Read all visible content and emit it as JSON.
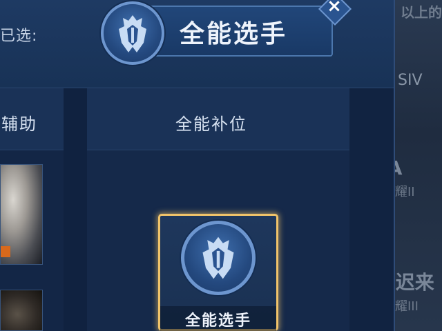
{
  "background": {
    "top_text": "以上的",
    "rank_1": "SIV",
    "player_1": "凉(A",
    "rank_1b": "耀II",
    "player_2": "(迟来",
    "rank_2": "耀III"
  },
  "dialog": {
    "title": "全能选手",
    "already_selected_label": "已选:",
    "close_icon": "×"
  },
  "columns": {
    "support_label": "辅助",
    "allround_label": "全能补位"
  },
  "selected_card": {
    "caption": "全能选手",
    "icon": "helmet-icon"
  },
  "colors": {
    "panel": "#14294a",
    "highlight": "#f0c36a",
    "emblem_ring": "#6d96cf"
  }
}
